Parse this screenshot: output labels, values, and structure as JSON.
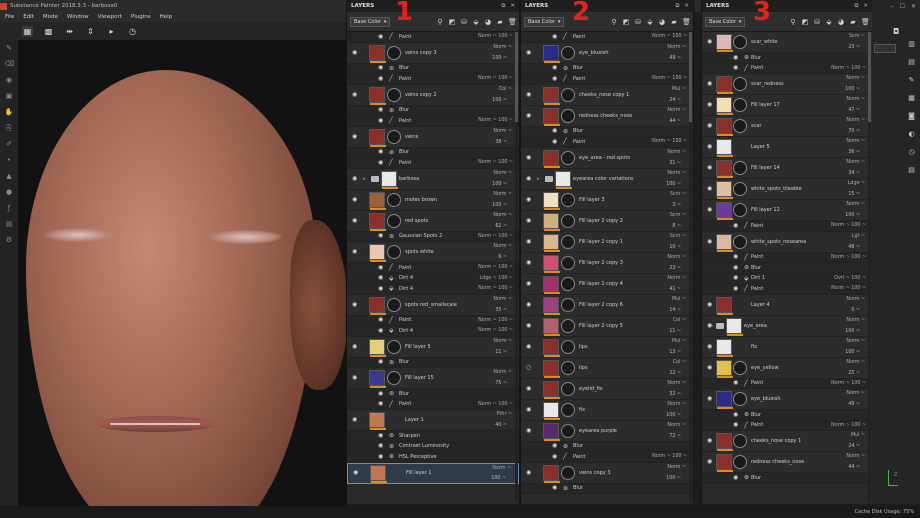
{
  "app": {
    "title": "Substance Painter 2018.3.3 - barbosa0"
  },
  "menu": [
    "File",
    "Edit",
    "Mode",
    "Window",
    "Viewport",
    "Plugins",
    "Help"
  ],
  "toolbar_icons": [
    "grid-icon",
    "grid-dense-icon",
    "symmetry-icon",
    "align-icon",
    "play-icon",
    "time-icon"
  ],
  "left_tools": [
    "paint-brush-icon",
    "eraser-icon",
    "projection-icon",
    "geometry-mask-icon",
    "smudge-icon",
    "clone-icon",
    "picker-icon",
    "dot-icon",
    "drop-icon",
    "sphere-icon",
    "fx-icon",
    "export-icon",
    "settings-icon"
  ],
  "status": {
    "cache": "Cache Disk Usage:   75%"
  },
  "axis": {
    "z": "Z"
  },
  "annotations": [
    "1",
    "2",
    "3"
  ],
  "panels": [
    {
      "header": "LAYERS",
      "channel": "Base Color",
      "rows": [
        {
          "t": "sub",
          "icon": "paint",
          "name": "Paint",
          "right": "Norm ~  100 ~"
        },
        {
          "t": "layer",
          "thumb": "#8a2f2a",
          "name": "veins copy 3",
          "blend": "Norm ~",
          "op": "100 ~"
        },
        {
          "t": "sub",
          "icon": "blur",
          "name": "Blur",
          "right": ""
        },
        {
          "t": "sub",
          "icon": "paint",
          "name": "Paint",
          "right": "Norm ~  100 ~"
        },
        {
          "t": "layer",
          "thumb": "#8a2f2a",
          "name": "veins copy 2",
          "blend": "Col ~",
          "op": "100 ~"
        },
        {
          "t": "sub",
          "icon": "blur",
          "name": "Blur",
          "right": ""
        },
        {
          "t": "sub",
          "icon": "paint",
          "name": "Paint",
          "right": "Norm ~  100 ~"
        },
        {
          "t": "layer",
          "thumb": "#8a2f2a",
          "name": "veins",
          "blend": "Norm ~",
          "op": "38 ~"
        },
        {
          "t": "sub",
          "icon": "blur",
          "name": "Blur",
          "right": ""
        },
        {
          "t": "sub",
          "icon": "paint",
          "name": "Paint",
          "right": "Norm ~  100 ~"
        },
        {
          "t": "folder",
          "thumb": "#e8e8e8",
          "name": "barbosa",
          "blend": "Norm ~",
          "op": "100 ~"
        },
        {
          "t": "layer",
          "thumb": "#9a6040",
          "name": "moles brown",
          "blend": "Norm ~",
          "op": "100 ~"
        },
        {
          "t": "layer",
          "thumb": "#8a2f2a",
          "name": "red spots",
          "blend": "Norm ~",
          "op": "62 ~"
        },
        {
          "t": "sub",
          "icon": "blur",
          "name": "Gaussian Spots 2",
          "right": "Norm ~  100 ~"
        },
        {
          "t": "layer",
          "thumb": "#e8c8b0",
          "name": "spots white",
          "blend": "Norm ~",
          "op": "6 ~"
        },
        {
          "t": "sub",
          "icon": "paint",
          "name": "Paint",
          "right": "Norm ~  100 ~"
        },
        {
          "t": "sub",
          "icon": "fill",
          "name": "Dirt 4",
          "right": "Ldge ~  100 ~"
        },
        {
          "t": "sub",
          "icon": "fill",
          "name": "Dirt 4",
          "right": "Norm ~  100 ~"
        },
        {
          "t": "layer",
          "thumb": "#8a2f2a",
          "name": "spots red_smallscale",
          "blend": "Norm ~",
          "op": "35 ~"
        },
        {
          "t": "sub",
          "icon": "paint",
          "name": "Paint",
          "right": "Norm ~  100 ~"
        },
        {
          "t": "sub",
          "icon": "fill",
          "name": "Dirt 4",
          "right": "Norm ~  100 ~"
        },
        {
          "t": "layer",
          "thumb": "#e0d080",
          "name": "Fill layer 5",
          "blend": "Norm ~",
          "op": "11 ~"
        },
        {
          "t": "sub",
          "icon": "blur",
          "name": "Blur",
          "right": ""
        },
        {
          "t": "layer",
          "thumb": "#3a3a8a",
          "name": "Fill layer 15",
          "blend": "Norm ~",
          "op": "75 ~"
        },
        {
          "t": "sub",
          "icon": "blur",
          "name": "Blur",
          "right": ""
        },
        {
          "t": "sub",
          "icon": "paint",
          "name": "Paint",
          "right": "Norm ~  100 ~"
        },
        {
          "t": "layer",
          "thumb": "#c07850",
          "name": "Layer 1",
          "blend": "Pthr ~",
          "op": "40 ~",
          "nomask": true
        },
        {
          "t": "sub",
          "icon": "blur",
          "name": "Sharpen",
          "right": ""
        },
        {
          "t": "sub",
          "icon": "blur",
          "name": "Contrast Luminosity",
          "right": ""
        },
        {
          "t": "sub",
          "icon": "blur",
          "name": "HSL Perceptive",
          "right": ""
        },
        {
          "t": "layer",
          "thumb": "#c07850",
          "name": "Fill layer 1",
          "blend": "Norm ~",
          "op": "100 ~",
          "nomask": true,
          "selected": true
        }
      ]
    },
    {
      "header": "LAYERS",
      "channel": "Base Color",
      "rows": [
        {
          "t": "sub",
          "icon": "paint",
          "name": "Paint",
          "right": "Norm ~  100 ~"
        },
        {
          "t": "layer",
          "thumb": "#2a2a8a",
          "name": "eye_blueish",
          "blend": "Norm ~",
          "op": "49 ~"
        },
        {
          "t": "sub",
          "icon": "blur",
          "name": "Blur",
          "right": ""
        },
        {
          "t": "sub",
          "icon": "paint",
          "name": "Paint",
          "right": "Norm ~  100 ~"
        },
        {
          "t": "layer",
          "thumb": "#8a2f2a",
          "name": "cheeks_nose copy 1",
          "blend": "Mul ~",
          "op": "24 ~"
        },
        {
          "t": "layer",
          "thumb": "#8a2f2a",
          "name": "redness cheeks_nose",
          "blend": "Norm ~",
          "op": "44 ~"
        },
        {
          "t": "sub",
          "icon": "blur",
          "name": "Blur",
          "right": ""
        },
        {
          "t": "sub",
          "icon": "paint",
          "name": "Paint",
          "right": "Norm ~  100 ~"
        },
        {
          "t": "layer",
          "thumb": "#8a2f2a",
          "name": "eye_area - red spots",
          "blend": "Norm ~",
          "op": "31 ~"
        },
        {
          "t": "folder",
          "thumb": "#e8e8e8",
          "name": "eyearea color variations",
          "blend": "Norm ~",
          "op": "100 ~"
        },
        {
          "t": "layer",
          "thumb": "#f0e0c0",
          "name": "Fill layer 3",
          "blend": "Scrn ~",
          "op": "3 ~"
        },
        {
          "t": "layer",
          "thumb": "#d0b080",
          "name": "Fill layer 2 copy 2",
          "blend": "Scrn ~",
          "op": "8 ~"
        },
        {
          "t": "layer",
          "thumb": "#d8b890",
          "name": "Fill layer 2 copy 1",
          "blend": "Scrn ~",
          "op": "10 ~"
        },
        {
          "t": "layer",
          "thumb": "#d05070",
          "name": "Fill layer 2 copy 3",
          "blend": "Norm ~",
          "op": "23 ~"
        },
        {
          "t": "layer",
          "thumb": "#a03070",
          "name": "Fill layer 2 copy 4",
          "blend": "Norm ~",
          "op": "41 ~"
        },
        {
          "t": "layer",
          "thumb": "#a04080",
          "name": "Fill layer 2 copy 6",
          "blend": "Mul ~",
          "op": "14 ~"
        },
        {
          "t": "layer",
          "thumb": "#b06070",
          "name": "Fill layer 2 copy 5",
          "blend": "Col ~",
          "op": "11 ~"
        },
        {
          "t": "layer",
          "thumb": "#8a2f2a",
          "name": "lips",
          "blend": "Mul ~",
          "op": "13 ~"
        },
        {
          "t": "layer",
          "thumb": "#8a2f2a",
          "name": "lips",
          "blend": "Col ~",
          "op": "22 ~",
          "eyeoff": true
        },
        {
          "t": "layer",
          "thumb": "#8a2f2a",
          "name": "eyelid_fix",
          "blend": "Norm ~",
          "op": "32 ~"
        },
        {
          "t": "layer",
          "thumb": "#e8e8e8",
          "name": "fix",
          "blend": "Norm ~",
          "op": "100 ~"
        },
        {
          "t": "layer",
          "thumb": "#5a2a6a",
          "name": "eyearea purple",
          "blend": "Norm ~",
          "op": "72 ~"
        },
        {
          "t": "sub",
          "icon": "blur",
          "name": "Blur",
          "right": ""
        },
        {
          "t": "sub",
          "icon": "paint",
          "name": "Paint",
          "right": "Norm ~  100 ~"
        },
        {
          "t": "layer",
          "thumb": "#8a2f2a",
          "name": "veins copy 3",
          "blend": "Norm ~",
          "op": "100 ~"
        },
        {
          "t": "sub",
          "icon": "blur",
          "name": "Blur",
          "right": ""
        }
      ]
    },
    {
      "header": "LAYERS",
      "channel": "Base Color",
      "rows": [
        {
          "t": "layer",
          "thumb": "#d8b8b0",
          "name": "scar_white",
          "blend": "Scrn ~",
          "op": "23 ~"
        },
        {
          "t": "sub",
          "icon": "blur",
          "name": "Blur",
          "right": ""
        },
        {
          "t": "sub",
          "icon": "paint",
          "name": "Paint",
          "right": "Norm ~  100 ~"
        },
        {
          "t": "layer",
          "thumb": "#8a2f2a",
          "name": "scar_redness",
          "blend": "Norm ~",
          "op": "100 ~"
        },
        {
          "t": "layer",
          "thumb": "#f0e0b0",
          "name": "Fill layer 17",
          "blend": "Norm ~",
          "op": "47 ~"
        },
        {
          "t": "layer",
          "thumb": "#8a2f2a",
          "name": "scar",
          "blend": "Norm ~",
          "op": "70 ~"
        },
        {
          "t": "layer",
          "thumb": "#e8e8e8",
          "name": "Layer 5",
          "blend": "Norm ~",
          "op": "36 ~",
          "nomask": true
        },
        {
          "t": "layer",
          "thumb": "#8a2f2a",
          "name": "Fill layer 14",
          "blend": "Norm ~",
          "op": "34 ~"
        },
        {
          "t": "layer",
          "thumb": "#d8c0a0",
          "name": "white_spots_tileable",
          "blend": "Ldge ~",
          "op": "15 ~"
        },
        {
          "t": "layer",
          "thumb": "#6a3aa0",
          "name": "Fill layer 12",
          "blend": "Norm ~",
          "op": "100 ~"
        },
        {
          "t": "sub",
          "icon": "paint",
          "name": "Paint",
          "right": "Norm ~  100 ~"
        },
        {
          "t": "layer",
          "thumb": "#d8b8a0",
          "name": "white_spots_nosearea",
          "blend": "Lgt ~",
          "op": "48 ~"
        },
        {
          "t": "sub",
          "icon": "paint",
          "name": "Paint",
          "right": "Norm ~  100 ~"
        },
        {
          "t": "sub",
          "icon": "blur",
          "name": "Blur",
          "right": ""
        },
        {
          "t": "sub",
          "icon": "fill",
          "name": "Dirt 1",
          "right": "Ovrl ~  100 ~"
        },
        {
          "t": "sub",
          "icon": "paint",
          "name": "Paint",
          "right": "Norm ~  100 ~"
        },
        {
          "t": "layer",
          "thumb": "#8a2f2a",
          "name": "Layer 4",
          "blend": "Norm ~",
          "op": "0 ~",
          "nomask": true
        },
        {
          "t": "folder",
          "thumb": "#e8e8e8",
          "name": "eye_area",
          "blend": "Norm ~",
          "op": "100 ~"
        },
        {
          "t": "layer",
          "thumb": "#e8e8e8",
          "name": "fix",
          "blend": "Norm ~",
          "op": "100 ~",
          "nomask": true
        },
        {
          "t": "layer",
          "thumb": "#e0c050",
          "name": "eye_yellow",
          "blend": "Norm ~",
          "op": "25 ~"
        },
        {
          "t": "sub",
          "icon": "paint",
          "name": "Paint",
          "right": "Norm ~  100 ~"
        },
        {
          "t": "layer",
          "thumb": "#2a2a8a",
          "name": "eye_blueish",
          "blend": "Norm ~",
          "op": "49 ~"
        },
        {
          "t": "sub",
          "icon": "blur",
          "name": "Blur",
          "right": ""
        },
        {
          "t": "sub",
          "icon": "paint",
          "name": "Paint",
          "right": "Norm ~  100 ~"
        },
        {
          "t": "layer",
          "thumb": "#8a2f2a",
          "name": "cheeks_nose copy 1",
          "blend": "Mul ~",
          "op": "24 ~"
        },
        {
          "t": "layer",
          "thumb": "#8a2f2a",
          "name": "redness cheeks_nose",
          "blend": "Norm ~",
          "op": "44 ~"
        },
        {
          "t": "sub",
          "icon": "blur",
          "name": "Blur",
          "right": ""
        }
      ]
    }
  ]
}
